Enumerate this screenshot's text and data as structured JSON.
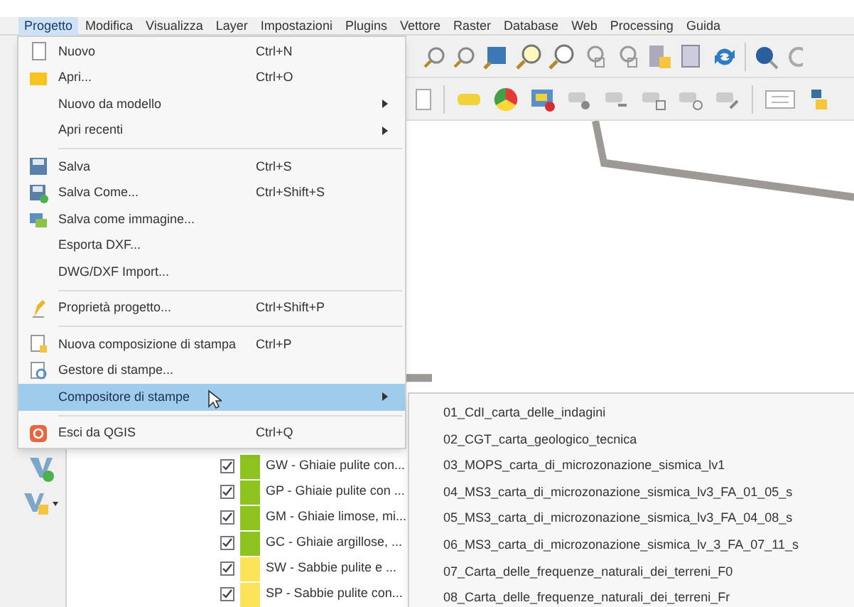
{
  "menubar": [
    {
      "label": "Progetto",
      "selected": true
    },
    {
      "label": "Modifica",
      "selected": false
    },
    {
      "label": "Visualizza",
      "selected": false
    },
    {
      "label": "Layer",
      "selected": false
    },
    {
      "label": "Impostazioni",
      "selected": false
    },
    {
      "label": "Plugins",
      "selected": false
    },
    {
      "label": "Vettore",
      "selected": false
    },
    {
      "label": "Raster",
      "selected": false
    },
    {
      "label": "Database",
      "selected": false
    },
    {
      "label": "Web",
      "selected": false
    },
    {
      "label": "Processing",
      "selected": false
    },
    {
      "label": "Guida",
      "selected": false
    }
  ],
  "menu": [
    {
      "kind": "item",
      "label": "Nuovo",
      "shortcut": "Ctrl+N",
      "submenu": false,
      "selected": false
    },
    {
      "kind": "item",
      "label": "Apri...",
      "shortcut": "Ctrl+O",
      "submenu": false,
      "selected": false
    },
    {
      "kind": "item",
      "label": "Nuovo da modello",
      "submenu": true,
      "selected": false
    },
    {
      "kind": "item",
      "label": "Apri recenti",
      "submenu": true,
      "selected": false
    },
    {
      "kind": "separator"
    },
    {
      "kind": "item",
      "label": "Salva",
      "shortcut": "Ctrl+S",
      "submenu": false,
      "selected": false
    },
    {
      "kind": "item",
      "label": "Salva Come...",
      "shortcut": "Ctrl+Shift+S",
      "submenu": false,
      "selected": false
    },
    {
      "kind": "item",
      "label": "Salva come immagine...",
      "submenu": false,
      "selected": false
    },
    {
      "kind": "item",
      "label": "Esporta DXF...",
      "submenu": false,
      "selected": false
    },
    {
      "kind": "item",
      "label": "DWG/DXF Import...",
      "submenu": false,
      "selected": false
    },
    {
      "kind": "separator"
    },
    {
      "kind": "item",
      "label": "Proprietà progetto...",
      "shortcut": "Ctrl+Shift+P",
      "submenu": false,
      "selected": false
    },
    {
      "kind": "separator"
    },
    {
      "kind": "item",
      "label": "Nuova composizione di stampa",
      "shortcut": "Ctrl+P",
      "submenu": false,
      "selected": false
    },
    {
      "kind": "item",
      "label": "Gestore di stampe...",
      "submenu": false,
      "selected": false
    },
    {
      "kind": "item",
      "label": "Compositore di stampe",
      "submenu": true,
      "selected": true
    },
    {
      "kind": "separator"
    },
    {
      "kind": "item",
      "label": "Esci da QGIS",
      "shortcut": "Ctrl+Q",
      "submenu": false,
      "selected": false
    }
  ],
  "submenu": [
    "01_CdI_carta_delle_indagini",
    "02_CGT_carta_geologico_tecnica",
    "03_MOPS_carta_di_microzonazione_sismica_lv1",
    "04_MS3_carta_di_microzonazione_sismica_lv3_FA_01_05_s",
    "05_MS3_carta_di_microzonazione_sismica_lv3_FA_04_08_s",
    "06_MS3_carta_di_microzonazione_sismica_lv_3_FA_07_11_s",
    "07_Carta_delle_frequenze_naturali_dei_terreni_F0",
    "08_Carta_delle_frequenze_naturali_dei_terreni_Fr"
  ],
  "layers": [
    {
      "label": "GW - Ghiaie pulite con...",
      "checked": true,
      "color": "#8dc21f"
    },
    {
      "label": "GP - Ghiaie pulite con ...",
      "checked": true,
      "color": "#8dc21f"
    },
    {
      "label": "GM - Ghiaie limose, mi...",
      "checked": true,
      "color": "#8dc21f"
    },
    {
      "label": "GC - Ghiaie argillose, ...",
      "checked": true,
      "color": "#8dc21f"
    },
    {
      "label": "SW - Sabbie pulite e ...",
      "checked": true,
      "color": "#fde25a"
    },
    {
      "label": "SP - Sabbie pulite con...",
      "checked": true,
      "color": "#fde25a"
    }
  ]
}
